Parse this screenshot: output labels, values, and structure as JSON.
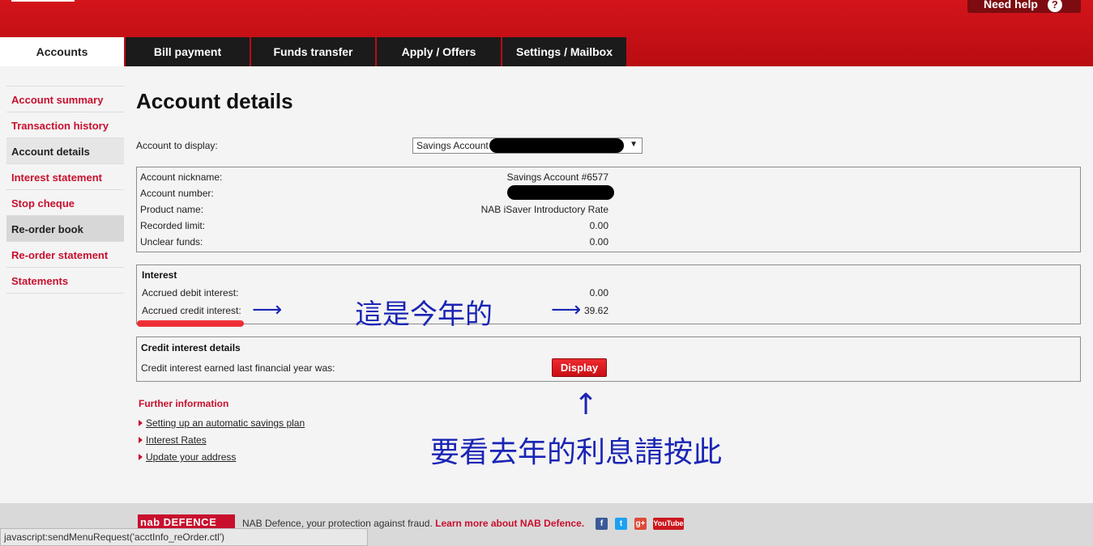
{
  "header": {
    "help_label": "Need help",
    "help_icon": "?"
  },
  "tabs": [
    {
      "label": "Accounts",
      "active": true
    },
    {
      "label": "Bill payment"
    },
    {
      "label": "Funds transfer"
    },
    {
      "label": "Apply / Offers"
    },
    {
      "label": "Settings / Mailbox"
    }
  ],
  "sidebar": {
    "items": [
      {
        "label": "Account summary"
      },
      {
        "label": "Transaction history"
      },
      {
        "label": "Account details",
        "current": true
      },
      {
        "label": "Interest statement"
      },
      {
        "label": "Stop cheque"
      },
      {
        "label": "Re-order book",
        "hover": true
      },
      {
        "label": "Re-order statement"
      },
      {
        "label": "Statements"
      }
    ]
  },
  "page_title": "Account details",
  "account_select": {
    "label": "Account to display:",
    "value": "Savings Account"
  },
  "account_info": [
    {
      "label": "Account nickname:",
      "value": "Savings Account #6577"
    },
    {
      "label": "Account number:",
      "value": ""
    },
    {
      "label": "Product name:",
      "value": "NAB iSaver Introductory Rate"
    },
    {
      "label": "Recorded limit:",
      "value": "0.00"
    },
    {
      "label": "Unclear funds:",
      "value": "0.00"
    }
  ],
  "interest": {
    "heading": "Interest",
    "debit_label": "Accrued debit interest:",
    "debit_value": "0.00",
    "credit_label": "Accrued credit interest:",
    "credit_value": "39.62"
  },
  "credit_details": {
    "heading": "Credit interest details",
    "label": "Credit interest earned last financial year was:",
    "button": "Display"
  },
  "further": {
    "heading": "Further information",
    "links": [
      "Setting up an automatic savings plan",
      "Interest Rates",
      "Update your address"
    ]
  },
  "annotations": {
    "arrow": "⟶",
    "up_arrow": "↑",
    "this_year": "這是今年的",
    "click_here": "要看去年的利息請按此"
  },
  "footer": {
    "logo_a": "nab",
    "logo_b": "DEFENCE",
    "text": "NAB Defence, your protection against fraud.",
    "link": "Learn more about NAB Defence.",
    "social": [
      "f",
      "t",
      "g+",
      "YouTube"
    ]
  },
  "status_bar": "javascript:sendMenuRequest('acctInfo_reOrder.ctl')"
}
